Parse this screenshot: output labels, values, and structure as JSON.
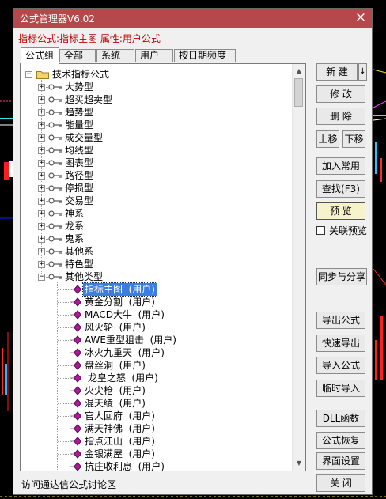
{
  "window": {
    "title": "公式管理器V6.02",
    "close_symbol": "×"
  },
  "info_line": "指标公式:指标主图 属性:用户公式",
  "tabs": [
    {
      "label": "公式组"
    },
    {
      "label": "全部"
    },
    {
      "label": "系统"
    },
    {
      "label": "用户"
    },
    {
      "label": "按日期频度"
    }
  ],
  "tree": {
    "root": {
      "label": "技术指标公式",
      "expander": "−",
      "icon": "folder-icon"
    },
    "groups": [
      {
        "label": "大势型",
        "expander": "+"
      },
      {
        "label": "超买超卖型",
        "expander": "+"
      },
      {
        "label": "趋势型",
        "expander": "+"
      },
      {
        "label": "能量型",
        "expander": "+"
      },
      {
        "label": "成交量型",
        "expander": "+"
      },
      {
        "label": "均线型",
        "expander": "+"
      },
      {
        "label": "图表型",
        "expander": "+"
      },
      {
        "label": "路径型",
        "expander": "+"
      },
      {
        "label": "停损型",
        "expander": "+"
      },
      {
        "label": "交易型",
        "expander": "+"
      },
      {
        "label": "神系",
        "expander": "+"
      },
      {
        "label": "龙系",
        "expander": "+"
      },
      {
        "label": "鬼系",
        "expander": "+"
      },
      {
        "label": "其他系",
        "expander": "+"
      },
      {
        "label": "特色型",
        "expander": "+"
      },
      {
        "label": "其他类型",
        "expander": "−"
      }
    ],
    "formulas": [
      {
        "label": "指标主图  (用户)",
        "selected": true
      },
      {
        "label": "黄金分割  (用户)"
      },
      {
        "label": "MACD大牛  (用户)"
      },
      {
        "label": "风火轮  (用户)"
      },
      {
        "label": "AWE重型狙击  (用户)"
      },
      {
        "label": "冰火九重天  (用户)"
      },
      {
        "label": "盘丝洞  (用户)"
      },
      {
        "label": " 龙皇之怒  (用户)"
      },
      {
        "label": "火尖枪  (用户)"
      },
      {
        "label": "混天绫  (用户)"
      },
      {
        "label": "官人回府  (用户)"
      },
      {
        "label": "满天神佛  (用户)"
      },
      {
        "label": "指点江山  (用户)"
      },
      {
        "label": "金银满屋  (用户)"
      },
      {
        "label": "抗庄收利息  (用户)"
      }
    ],
    "scroll_arrows": {
      "up": "▲",
      "down": "▼"
    }
  },
  "buttons": {
    "new": "新 建",
    "new_dropdown": "↓",
    "modify": "修 改",
    "delete": "删 除",
    "move_up": "上移",
    "move_down": "下移",
    "add_common": "加入常用",
    "find": "查找(F3)",
    "preview": "预 览",
    "linked_preview": "关联预览",
    "sync_share": "同步与分享",
    "export": "导出公式",
    "quick_export": "快速导出",
    "import": "导入公式",
    "temp_import": "临时导入",
    "dll": "DLL函数",
    "restore": "公式恢复",
    "interface": "界面设置",
    "close": "关 闭"
  },
  "footer_link": "访问通达信公式讨论区",
  "colors": {
    "titlebar": "#b5484b",
    "info_text": "#c00000",
    "selection": "#3b7ee0",
    "diamond": "#b0189a"
  }
}
